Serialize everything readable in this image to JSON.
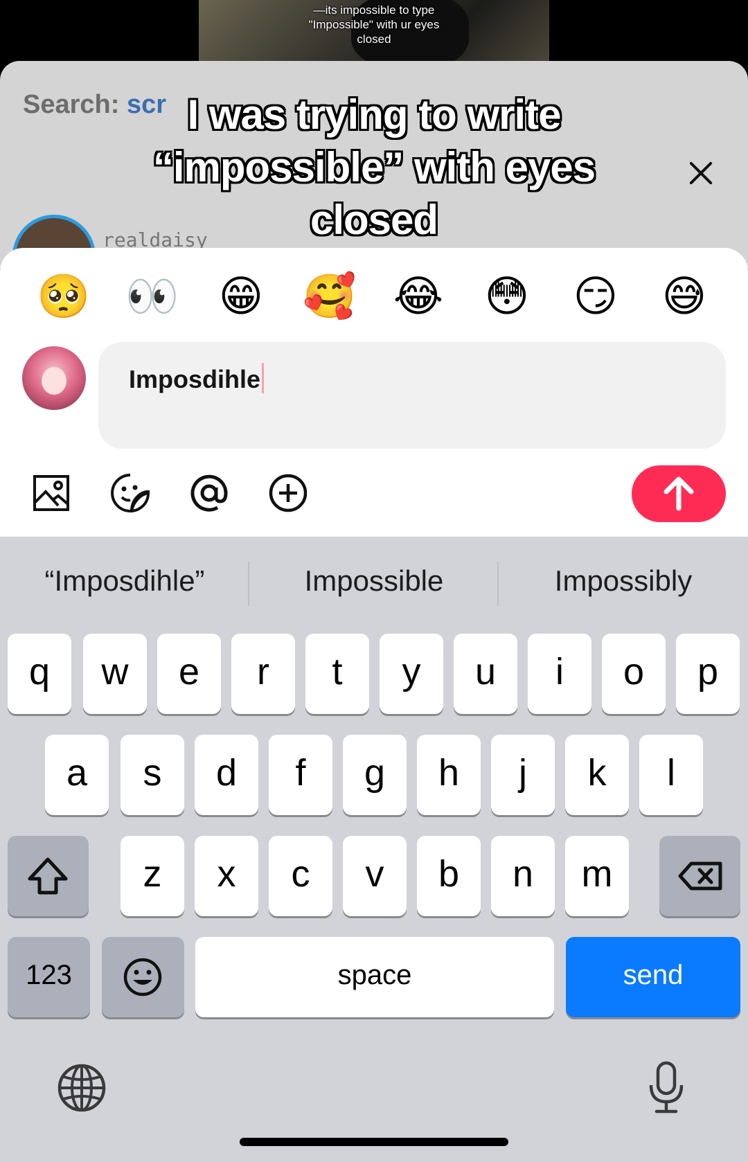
{
  "video": {
    "caption_line1": "—its impossible to type",
    "caption_line2": "\"Impossible\" with ur eyes",
    "caption_line3": "closed"
  },
  "overlay": {
    "line1": "I was trying to write",
    "line2": "“impossible” with eyes",
    "line3": "closed"
  },
  "comment_sheet": {
    "search_label": "Search:",
    "search_term": "scr",
    "partial_username": "realdaisy"
  },
  "emoji_bar": [
    "🥺",
    "👀",
    "😁",
    "🥰",
    "😂",
    "😳",
    "😏",
    "😅"
  ],
  "composer": {
    "input_value": "Imposdihle",
    "tools": [
      "image-icon",
      "sticker-icon",
      "mention-icon",
      "add-icon"
    ],
    "send_icon": "arrow-up-icon",
    "send_color": "#fe2c55"
  },
  "keyboard": {
    "suggestions": [
      "“Imposdihle”",
      "Impossible",
      "Impossibly"
    ],
    "row1": [
      "q",
      "w",
      "e",
      "r",
      "t",
      "y",
      "u",
      "i",
      "o",
      "p"
    ],
    "row2": [
      "a",
      "s",
      "d",
      "f",
      "g",
      "h",
      "j",
      "k",
      "l"
    ],
    "row3": [
      "z",
      "x",
      "c",
      "v",
      "b",
      "n",
      "m"
    ],
    "numbers_key": "123",
    "space_key": "space",
    "send_key": "send",
    "send_key_color": "#0a7aff"
  }
}
